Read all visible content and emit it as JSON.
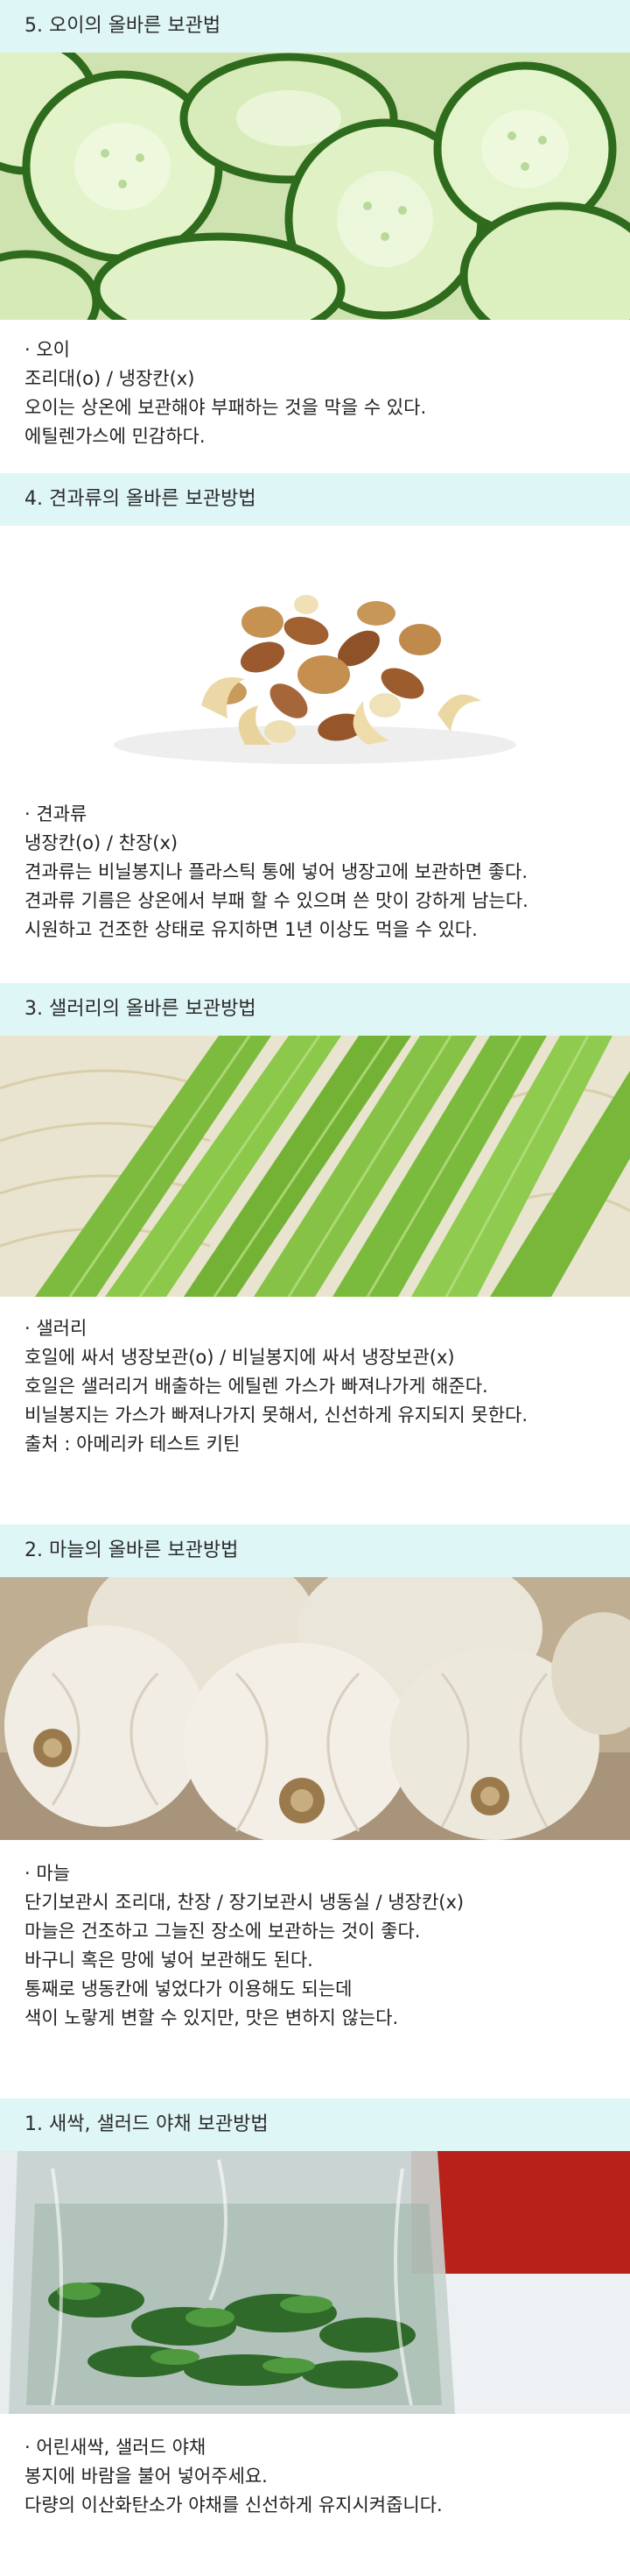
{
  "sections": [
    {
      "header": "5. 오이의 올바른 보관법",
      "image_icon": "cucumber-slices-photo",
      "lines": [
        "· 오이",
        "조리대(o) / 냉장칸(x)",
        "오이는 상온에 보관해야 부패하는 것을 막을 수 있다.",
        "에틸렌가스에 민감하다."
      ]
    },
    {
      "header": "4. 견과류의 올바른 보관방법",
      "image_icon": "mixed-nuts-photo",
      "lines": [
        "· 견과류",
        "냉장칸(o) / 찬장(x)",
        "견과류는 비닐봉지나 플라스틱 통에 넣어 냉장고에 보관하면 좋다.",
        "견과류 기름은 상온에서 부패 할 수 있으며 쓴 맛이 강하게 남는다.",
        "시원하고 건조한 상태로 유지하면 1년 이상도 먹을 수 있다."
      ]
    },
    {
      "header": "3. 샐러리의 올바른 보관방법",
      "image_icon": "celery-stalks-photo",
      "lines": [
        "· 샐러리",
        "호일에 싸서 냉장보관(o) / 비닐봉지에 싸서 냉장보관(x)",
        "호일은 샐러리거 배출하는 에틸렌 가스가 빠져나가게 해준다.",
        "비닐봉지는 가스가 빠져나가지 못해서, 신선하게 유지되지 못한다.",
        "출처 : 아메리카 테스트 키틴"
      ]
    },
    {
      "header": "2. 마늘의 올바른 보관방법",
      "image_icon": "garlic-bulbs-photo",
      "lines": [
        "· 마늘",
        "단기보관시 조리대, 찬장 / 장기보관시 냉동실 / 냉장칸(x)",
        "마늘은 건조하고 그늘진 장소에 보관하는 것이 좋다.",
        "바구니 혹은 망에 넣어 보관해도 된다.",
        "통째로 냉동칸에 넣었다가 이용해도 되는데",
        "색이 노랗게 변할 수 있지만, 맛은 변하지 않는다."
      ]
    },
    {
      "header": "1. 새싹, 샐러드 야채 보관방법",
      "image_icon": "greens-in-plastic-bag-photo",
      "lines": [
        "· 어린새싹, 샐러드 야채",
        "봉지에 바람을 불어 넣어주세요.",
        "다량의 이산화탄소가 야채를 신선하게 유지시켜줍니다."
      ]
    }
  ]
}
